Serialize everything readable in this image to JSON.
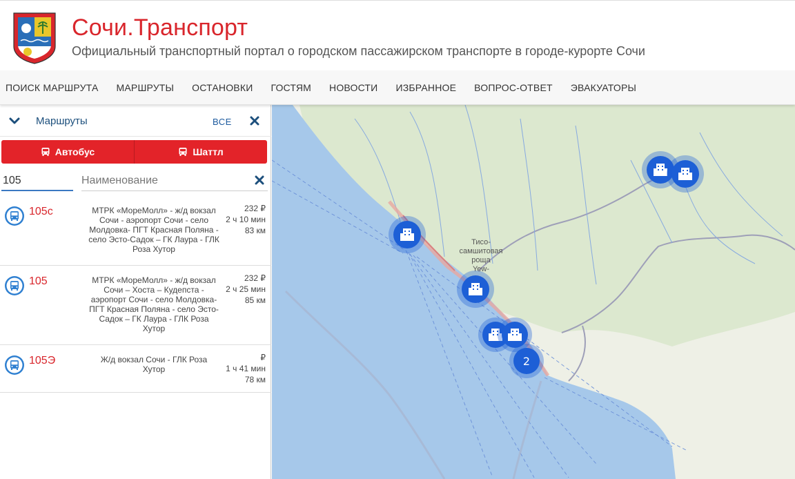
{
  "header": {
    "title": "Сочи.Транспорт",
    "subtitle": "Официальный транспортный портал о городском пассажирском транспорте в городе-курорте Сочи"
  },
  "nav": {
    "items": [
      {
        "label": "ПОИСК МАРШРУТА"
      },
      {
        "label": "МАРШРУТЫ"
      },
      {
        "label": "ОСТАНОВКИ"
      },
      {
        "label": "ГОСТЯМ"
      },
      {
        "label": "НОВОСТИ"
      },
      {
        "label": "ИЗБРАННОЕ"
      },
      {
        "label": "ВОПРОС-ОТВЕТ"
      },
      {
        "label": "ЭВАКУАТОРЫ"
      }
    ]
  },
  "sidebar": {
    "title": "Маршруты",
    "all_label": "ВСЕ",
    "type_buttons": {
      "bus": "Автобус",
      "shuttle": "Шаттл"
    },
    "filter": {
      "number_value": "105",
      "name_placeholder": "Наименование"
    },
    "routes": [
      {
        "number": "105с",
        "description": "МТРК «МореМолл» - ж/д вокзал Сочи - аэропорт Сочи - село Молдовка- ПГТ Красная Поляна - село Эсто-Садок – ГК Лаура - ГЛК Роза Хутор",
        "price": "232 ₽",
        "duration": "2 ч 10 мин",
        "distance": "83 км"
      },
      {
        "number": "105",
        "description": "МТРК «МореМолл» - ж/д вокзал Сочи – Хоста – Кудепста - аэропорт Сочи - село Молдовка- ПГТ Красная Поляна - село Эсто-Садок – ГК Лаура - ГЛК Роза Хутор",
        "price": "232 ₽",
        "duration": "2 ч 25 мин",
        "distance": "85 км"
      },
      {
        "number": "105Э",
        "description": "Ж/д вокзал Сочи - ГЛК Роза Хутор",
        "price": "₽",
        "duration": "1 ч 41 мин",
        "distance": "78 км"
      }
    ]
  },
  "map": {
    "place_label_1": "Тисо-",
    "place_label_2": "самшитовая",
    "place_label_3": "роща",
    "place_label_4": "Yew-",
    "cluster_count": "2",
    "sea_color": "#a6c8ea",
    "land_color": "#eef0e6",
    "cluster_color": "#1d5fd6"
  },
  "colors": {
    "brand_red": "#d9262c",
    "link_blue": "#1c5a9e"
  }
}
